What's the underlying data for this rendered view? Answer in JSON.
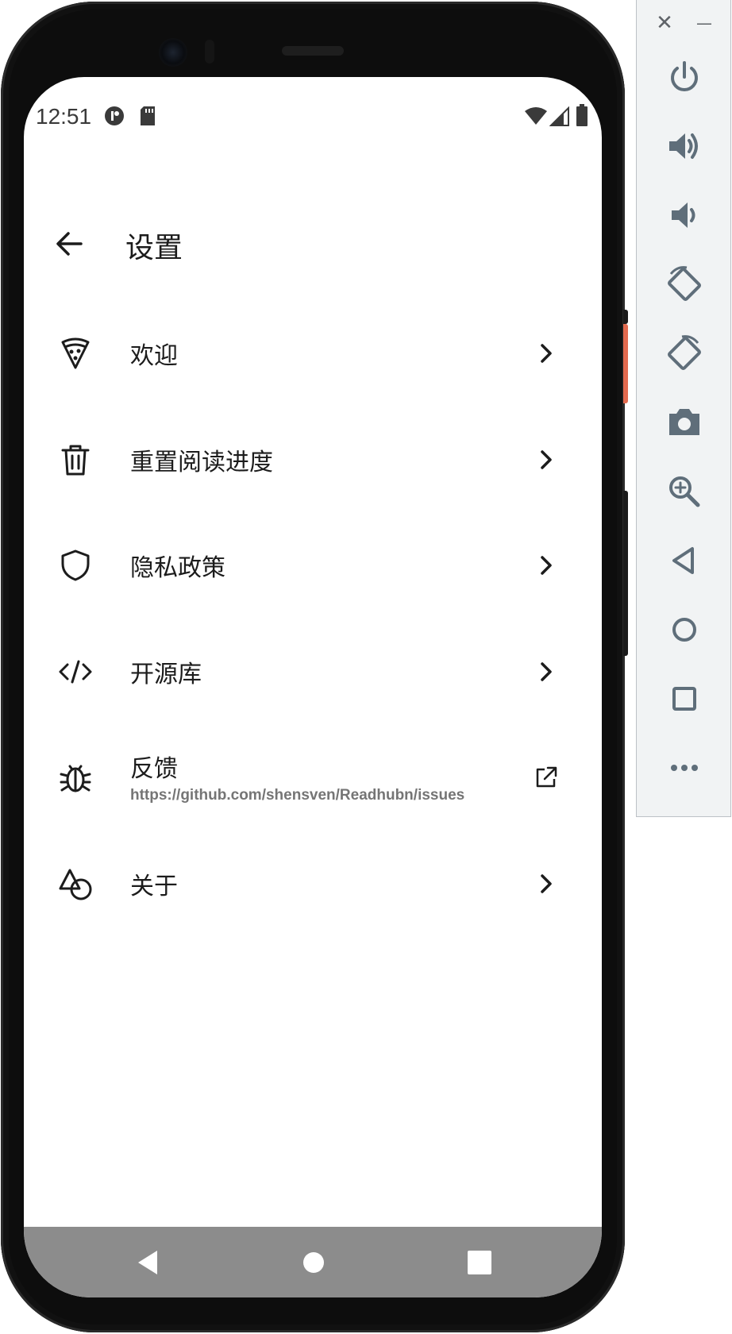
{
  "status_bar": {
    "time": "12:51"
  },
  "app_bar": {
    "title": "设置"
  },
  "settings_items": [
    {
      "label": "欢迎",
      "icon": "pizza-icon",
      "trailing": "chevron-right-icon"
    },
    {
      "label": "重置阅读进度",
      "icon": "trash-icon",
      "trailing": "chevron-right-icon"
    },
    {
      "label": "隐私政策",
      "icon": "shield-icon",
      "trailing": "chevron-right-icon"
    },
    {
      "label": "开源库",
      "icon": "code-icon",
      "trailing": "chevron-right-icon"
    },
    {
      "label": "反馈",
      "subtitle": "https://github.com/shensven/Readhubn/issues",
      "icon": "bug-icon",
      "trailing": "external-link-icon"
    },
    {
      "label": "关于",
      "icon": "shapes-icon",
      "trailing": "chevron-right-icon"
    }
  ],
  "emulator_controls": {
    "close_label": "✕",
    "minimize_label": "—",
    "buttons": [
      "power-icon",
      "volume-up-icon",
      "volume-down-icon",
      "rotate-left-icon",
      "rotate-right-icon",
      "camera-icon",
      "zoom-icon",
      "back-icon",
      "home-icon",
      "overview-icon",
      "more-icon"
    ]
  },
  "colors": {
    "text_primary": "#1c1c1c",
    "text_secondary": "#757575",
    "nav_bar": "#8c8c8c",
    "emulator_icon": "#5f6e7a"
  }
}
